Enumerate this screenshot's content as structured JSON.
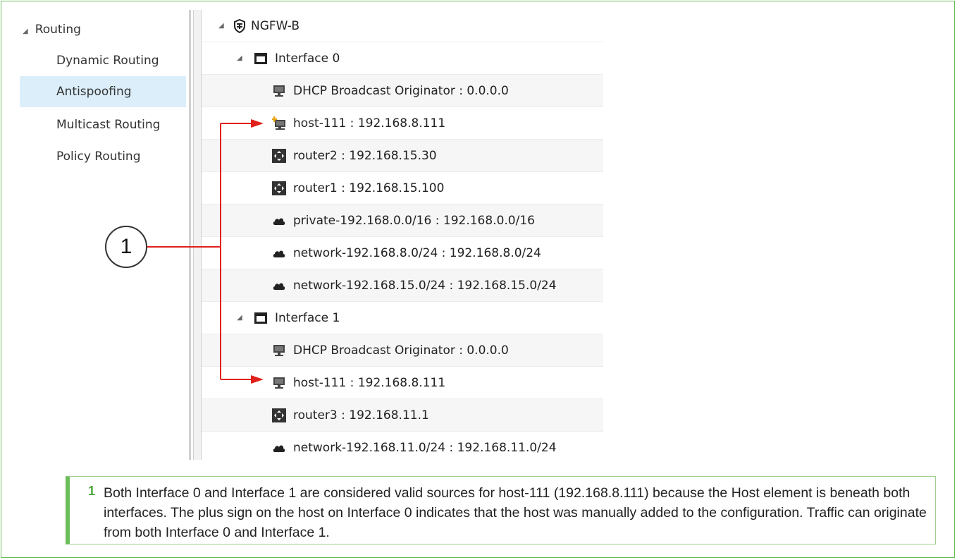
{
  "nav": {
    "group_label": "Routing",
    "items": [
      {
        "label": "Dynamic Routing"
      },
      {
        "label": "Antispoofing"
      },
      {
        "label": "Multicast Routing"
      },
      {
        "label": "Policy Routing"
      }
    ],
    "selected": "Antispoofing"
  },
  "tree": {
    "root": {
      "label": "NGFW-B",
      "icon": "shield-firewall-icon"
    },
    "interfaces": [
      {
        "label": "Interface 0",
        "icon": "interface-icon",
        "children": [
          {
            "label": "DHCP Broadcast Originator : 0.0.0.0",
            "icon": "host-icon"
          },
          {
            "label": "host-111 : 192.168.8.111",
            "icon": "host-added-icon"
          },
          {
            "label": "router2 : 192.168.15.30",
            "icon": "router-icon"
          },
          {
            "label": "router1 : 192.168.15.100",
            "icon": "router-icon"
          },
          {
            "label": "private-192.168.0.0/16 : 192.168.0.0/16",
            "icon": "network-cloud-icon"
          },
          {
            "label": "network-192.168.8.0/24 : 192.168.8.0/24",
            "icon": "network-cloud-icon"
          },
          {
            "label": "network-192.168.15.0/24 : 192.168.15.0/24",
            "icon": "network-cloud-icon"
          }
        ]
      },
      {
        "label": "Interface 1",
        "icon": "interface-icon",
        "children": [
          {
            "label": "DHCP Broadcast Originator : 0.0.0.0",
            "icon": "host-icon"
          },
          {
            "label": "host-111 : 192.168.8.111",
            "icon": "host-icon"
          },
          {
            "label": "router3 : 192.168.11.1",
            "icon": "router-icon"
          },
          {
            "label": "network-192.168.11.0/24 : 192.168.11.0/24",
            "icon": "network-cloud-icon"
          }
        ]
      }
    ]
  },
  "callout": {
    "number": "1"
  },
  "note": {
    "number": "1",
    "text": "Both Interface 0 and Interface 1 are considered valid sources for host-111 (192.168.8.111) because the Host element is beneath both interfaces. The plus sign on the host on Interface 0 indicates that the host was manually added to the configuration. Traffic can originate from both Interface 0 and Interface 1."
  },
  "colors": {
    "frame_border": "#6bbf59",
    "selection": "#dbeefa",
    "callout_arrow": "#e0201b",
    "note_number": "#4ca63c"
  }
}
